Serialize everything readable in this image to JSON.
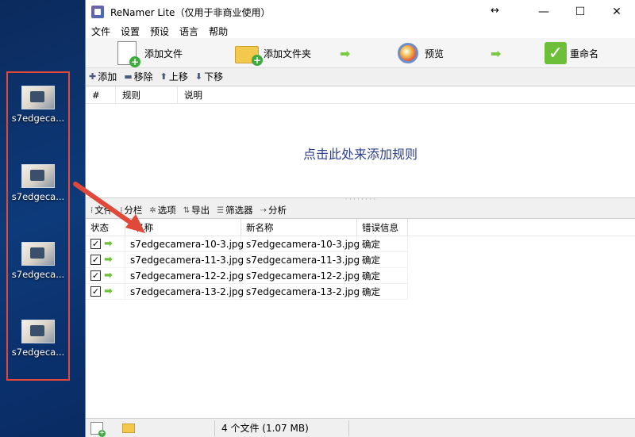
{
  "desktop": {
    "icons": [
      {
        "label": "s7edgeca..."
      },
      {
        "label": "s7edgeca..."
      },
      {
        "label": "s7edgeca..."
      },
      {
        "label": "s7edgeca..."
      }
    ],
    "highlight_color": "#e0483a"
  },
  "window": {
    "title": "ReNamer Lite（仅用于非商业使用）",
    "resize_glyph": "↔",
    "controls": {
      "minimize": "—",
      "maximize": "☐",
      "close": "✕"
    }
  },
  "menu": [
    "文件",
    "设置",
    "预设",
    "语言",
    "帮助"
  ],
  "toolbar": {
    "add_files": "添加文件",
    "add_folder": "添加文件夹",
    "preview": "预览",
    "rename": "重命名",
    "arrow": "➡"
  },
  "rules_toolbar": {
    "add": "添加",
    "remove": "移除",
    "up": "上移",
    "down": "下移"
  },
  "rules_table": {
    "columns": [
      "#",
      "规则",
      "说明"
    ],
    "hint": "点击此处来添加规则"
  },
  "files_toolbar": {
    "files": "文件",
    "columns": "分栏",
    "options": "选项",
    "export": "导出",
    "filters": "筛选器",
    "analyze": "分析"
  },
  "files_table": {
    "columns": [
      "状态",
      "名称",
      "新名称",
      "错误信息"
    ],
    "rows": [
      {
        "name": "s7edgecamera-10-3.jpg",
        "new_name": "s7edgecamera-10-3.jpg",
        "error": "确定",
        "checked": "✓"
      },
      {
        "name": "s7edgecamera-11-3.jpg",
        "new_name": "s7edgecamera-11-3.jpg",
        "error": "确定",
        "checked": "✓"
      },
      {
        "name": "s7edgecamera-12-2.jpg",
        "new_name": "s7edgecamera-12-2.jpg",
        "error": "确定",
        "checked": "✓"
      },
      {
        "name": "s7edgecamera-13-2.jpg",
        "new_name": "s7edgecamera-13-2.jpg",
        "error": "确定",
        "checked": "✓"
      }
    ]
  },
  "statusbar": {
    "text": "4 个文件 (1.07 MB)"
  },
  "colors": {
    "accent_arrow": "#6dbf3a",
    "annotation": "#e0483a",
    "hint_text": "#2b3f8c"
  }
}
